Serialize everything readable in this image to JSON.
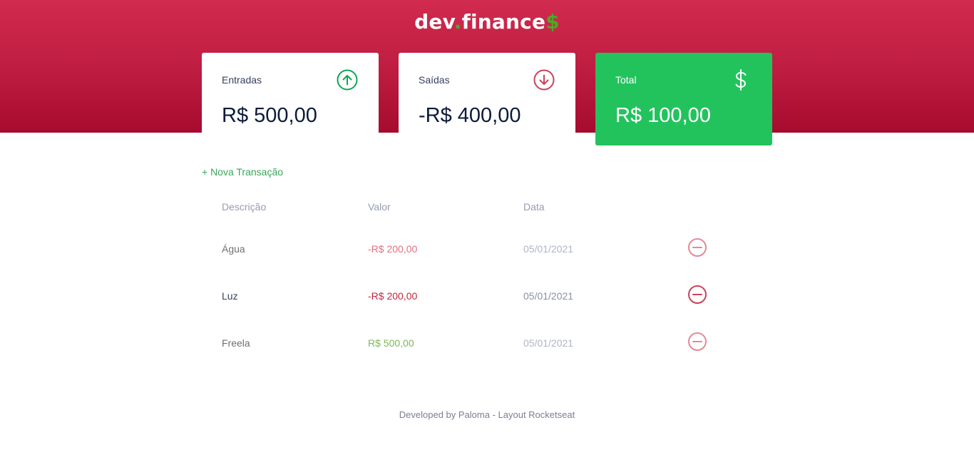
{
  "header": {
    "logo_main": "dev",
    "logo_dot": ".",
    "logo_finance": "finance",
    "logo_dollar": "$"
  },
  "cards": {
    "income": {
      "title": "Entradas",
      "value": "R$ 500,00",
      "icon": "arrow-up-circle-icon"
    },
    "expense": {
      "title": "Saídas",
      "value": "-R$ 400,00",
      "icon": "arrow-down-circle-icon"
    },
    "total": {
      "title": "Total",
      "value": "R$ 100,00",
      "icon": "dollar-icon"
    }
  },
  "actions": {
    "new_transaction": "+ Nova Transação"
  },
  "table": {
    "headers": [
      "Descrição",
      "Valor",
      "Data"
    ],
    "rows": [
      {
        "description": "Água",
        "amount": "-R$ 200,00",
        "date": "05/01/2021",
        "type": "expense"
      },
      {
        "description": "Luz",
        "amount": "-R$ 200,00",
        "date": "05/01/2021",
        "type": "expense"
      },
      {
        "description": "Freela",
        "amount": "R$ 500,00",
        "date": "05/01/2021",
        "type": "income"
      }
    ]
  },
  "footer": {
    "text": "Developed by Paloma - Layout Rocketseat"
  },
  "colors": {
    "header": "#bd1c40",
    "income": "#22c35d",
    "expense": "#e92929",
    "text": "#363f5f"
  }
}
